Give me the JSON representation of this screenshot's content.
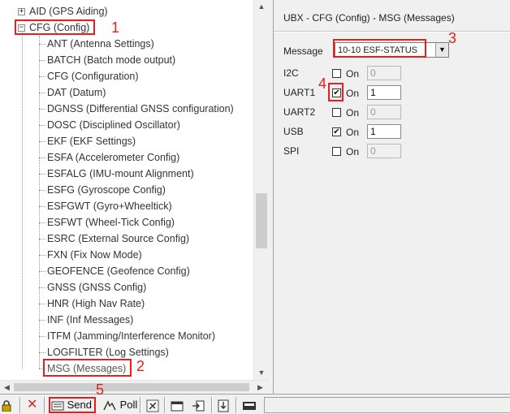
{
  "tree": {
    "items": [
      {
        "label": "AID (GPS Aiding)",
        "expander": "+"
      },
      {
        "label": "CFG (Config)",
        "expander": "−"
      },
      {
        "label": "ANT (Antenna Settings)"
      },
      {
        "label": "BATCH (Batch mode output)"
      },
      {
        "label": "CFG (Configuration)"
      },
      {
        "label": "DAT (Datum)"
      },
      {
        "label": "DGNSS (Differential GNSS configuration)"
      },
      {
        "label": "DOSC (Disciplined Oscillator)"
      },
      {
        "label": "EKF (EKF Settings)"
      },
      {
        "label": "ESFA (Accelerometer Config)"
      },
      {
        "label": "ESFALG (IMU-mount Alignment)"
      },
      {
        "label": "ESFG (Gyroscope Config)"
      },
      {
        "label": "ESFGWT (Gyro+Wheeltick)"
      },
      {
        "label": "ESFWT (Wheel-Tick Config)"
      },
      {
        "label": "ESRC (External Source Config)"
      },
      {
        "label": "FXN (Fix Now Mode)"
      },
      {
        "label": "GEOFENCE (Geofence Config)"
      },
      {
        "label": "GNSS (GNSS Config)"
      },
      {
        "label": "HNR (High Nav Rate)"
      },
      {
        "label": "INF (Inf Messages)"
      },
      {
        "label": "ITFM (Jamming/Interference Monitor)"
      },
      {
        "label": "LOGFILTER (Log Settings)"
      },
      {
        "label": "MSG (Messages)"
      }
    ]
  },
  "callouts": [
    "1",
    "2",
    "3",
    "4",
    "5"
  ],
  "panel": {
    "title": "UBX - CFG (Config) - MSG (Messages)",
    "message_label": "Message",
    "message_value": "10-10 ESF-STATUS",
    "on_label": "On",
    "ports": [
      {
        "name": "I2C",
        "checked": false,
        "value": "0",
        "enabled": false
      },
      {
        "name": "UART1",
        "checked": true,
        "value": "1",
        "enabled": true
      },
      {
        "name": "UART2",
        "checked": false,
        "value": "0",
        "enabled": false
      },
      {
        "name": "USB",
        "checked": true,
        "value": "1",
        "enabled": true
      },
      {
        "name": "SPI",
        "checked": false,
        "value": "0",
        "enabled": false
      }
    ]
  },
  "toolbar": {
    "send_label": "Send",
    "poll_label": "Poll"
  },
  "colors": {
    "annotation": "#e81e1e",
    "tree_highlight_text": "#333333"
  }
}
